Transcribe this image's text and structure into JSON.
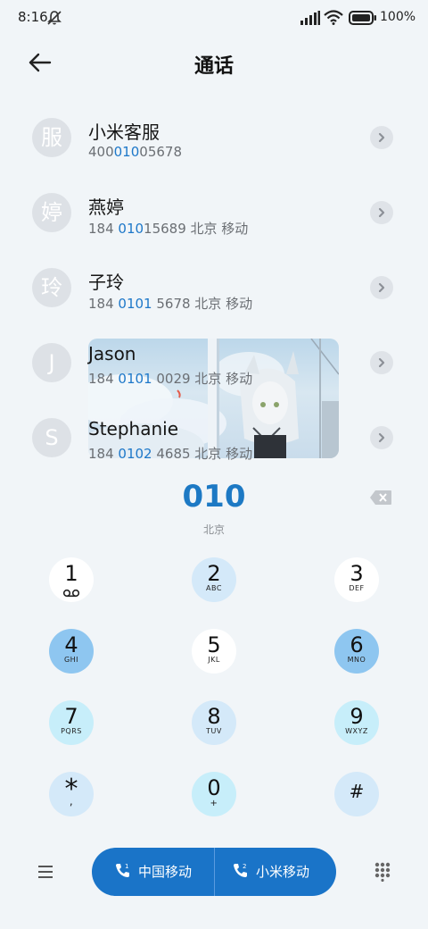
{
  "status": {
    "time": "8:16",
    "battery": "100%"
  },
  "header": {
    "title": "通话"
  },
  "contacts": [
    {
      "avatar": "服",
      "name": "小米客服",
      "num_pre": "400",
      "num_hl": "010",
      "num_post": "05678"
    },
    {
      "avatar": "婷",
      "name": "燕婷",
      "num_pre": "184 ",
      "num_hl": "010",
      "num_post": "15689  北京 移动"
    },
    {
      "avatar": "玲",
      "name": "子玲",
      "num_pre": "184 ",
      "num_hl": "0101",
      "num_post": " 5678  北京 移动"
    },
    {
      "avatar": "J",
      "name": "Jason",
      "num_pre": "184 ",
      "num_hl": "0101",
      "num_post": " 0029  北京 移动"
    },
    {
      "avatar": "S",
      "name": "Stephanie",
      "num_pre": "184 ",
      "num_hl": "0102",
      "num_post": " 4685  北京 移动"
    }
  ],
  "dial": {
    "number": "010",
    "location": "北京"
  },
  "keys": [
    {
      "digit": "1",
      "letters": ""
    },
    {
      "digit": "2",
      "letters": "ABC"
    },
    {
      "digit": "3",
      "letters": "DEF"
    },
    {
      "digit": "4",
      "letters": "GHI"
    },
    {
      "digit": "5",
      "letters": "JKL"
    },
    {
      "digit": "6",
      "letters": "MNO"
    },
    {
      "digit": "7",
      "letters": "PQRS"
    },
    {
      "digit": "8",
      "letters": "TUV"
    },
    {
      "digit": "9",
      "letters": "WXYZ"
    },
    {
      "digit": "*",
      "letters": ","
    },
    {
      "digit": "0",
      "letters": "+"
    },
    {
      "digit": "#",
      "letters": ""
    }
  ],
  "call": {
    "sim1_label": "中国移动",
    "sim2_label": "小米移动",
    "sim1_index": "1",
    "sim2_index": "2"
  },
  "colors": {
    "accent": "#1a74c8",
    "highlight": "#1e78c9"
  }
}
